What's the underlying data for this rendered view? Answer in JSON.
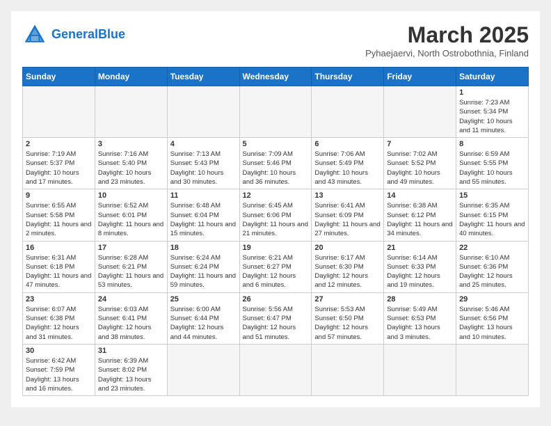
{
  "header": {
    "logo_general": "General",
    "logo_blue": "Blue",
    "title": "March 2025",
    "subtitle": "Pyhaejaervi, North Ostrobothnia, Finland"
  },
  "days_of_week": [
    "Sunday",
    "Monday",
    "Tuesday",
    "Wednesday",
    "Thursday",
    "Friday",
    "Saturday"
  ],
  "weeks": [
    [
      {
        "day": "",
        "info": ""
      },
      {
        "day": "",
        "info": ""
      },
      {
        "day": "",
        "info": ""
      },
      {
        "day": "",
        "info": ""
      },
      {
        "day": "",
        "info": ""
      },
      {
        "day": "",
        "info": ""
      },
      {
        "day": "1",
        "info": "Sunrise: 7:23 AM\nSunset: 5:34 PM\nDaylight: 10 hours and 11 minutes."
      }
    ],
    [
      {
        "day": "2",
        "info": "Sunrise: 7:19 AM\nSunset: 5:37 PM\nDaylight: 10 hours and 17 minutes."
      },
      {
        "day": "3",
        "info": "Sunrise: 7:16 AM\nSunset: 5:40 PM\nDaylight: 10 hours and 23 minutes."
      },
      {
        "day": "4",
        "info": "Sunrise: 7:13 AM\nSunset: 5:43 PM\nDaylight: 10 hours and 30 minutes."
      },
      {
        "day": "5",
        "info": "Sunrise: 7:09 AM\nSunset: 5:46 PM\nDaylight: 10 hours and 36 minutes."
      },
      {
        "day": "6",
        "info": "Sunrise: 7:06 AM\nSunset: 5:49 PM\nDaylight: 10 hours and 43 minutes."
      },
      {
        "day": "7",
        "info": "Sunrise: 7:02 AM\nSunset: 5:52 PM\nDaylight: 10 hours and 49 minutes."
      },
      {
        "day": "8",
        "info": "Sunrise: 6:59 AM\nSunset: 5:55 PM\nDaylight: 10 hours and 55 minutes."
      }
    ],
    [
      {
        "day": "9",
        "info": "Sunrise: 6:55 AM\nSunset: 5:58 PM\nDaylight: 11 hours and 2 minutes."
      },
      {
        "day": "10",
        "info": "Sunrise: 6:52 AM\nSunset: 6:01 PM\nDaylight: 11 hours and 8 minutes."
      },
      {
        "day": "11",
        "info": "Sunrise: 6:48 AM\nSunset: 6:04 PM\nDaylight: 11 hours and 15 minutes."
      },
      {
        "day": "12",
        "info": "Sunrise: 6:45 AM\nSunset: 6:06 PM\nDaylight: 11 hours and 21 minutes."
      },
      {
        "day": "13",
        "info": "Sunrise: 6:41 AM\nSunset: 6:09 PM\nDaylight: 11 hours and 27 minutes."
      },
      {
        "day": "14",
        "info": "Sunrise: 6:38 AM\nSunset: 6:12 PM\nDaylight: 11 hours and 34 minutes."
      },
      {
        "day": "15",
        "info": "Sunrise: 6:35 AM\nSunset: 6:15 PM\nDaylight: 11 hours and 40 minutes."
      }
    ],
    [
      {
        "day": "16",
        "info": "Sunrise: 6:31 AM\nSunset: 6:18 PM\nDaylight: 11 hours and 47 minutes."
      },
      {
        "day": "17",
        "info": "Sunrise: 6:28 AM\nSunset: 6:21 PM\nDaylight: 11 hours and 53 minutes."
      },
      {
        "day": "18",
        "info": "Sunrise: 6:24 AM\nSunset: 6:24 PM\nDaylight: 11 hours and 59 minutes."
      },
      {
        "day": "19",
        "info": "Sunrise: 6:21 AM\nSunset: 6:27 PM\nDaylight: 12 hours and 6 minutes."
      },
      {
        "day": "20",
        "info": "Sunrise: 6:17 AM\nSunset: 6:30 PM\nDaylight: 12 hours and 12 minutes."
      },
      {
        "day": "21",
        "info": "Sunrise: 6:14 AM\nSunset: 6:33 PM\nDaylight: 12 hours and 19 minutes."
      },
      {
        "day": "22",
        "info": "Sunrise: 6:10 AM\nSunset: 6:36 PM\nDaylight: 12 hours and 25 minutes."
      }
    ],
    [
      {
        "day": "23",
        "info": "Sunrise: 6:07 AM\nSunset: 6:38 PM\nDaylight: 12 hours and 31 minutes."
      },
      {
        "day": "24",
        "info": "Sunrise: 6:03 AM\nSunset: 6:41 PM\nDaylight: 12 hours and 38 minutes."
      },
      {
        "day": "25",
        "info": "Sunrise: 6:00 AM\nSunset: 6:44 PM\nDaylight: 12 hours and 44 minutes."
      },
      {
        "day": "26",
        "info": "Sunrise: 5:56 AM\nSunset: 6:47 PM\nDaylight: 12 hours and 51 minutes."
      },
      {
        "day": "27",
        "info": "Sunrise: 5:53 AM\nSunset: 6:50 PM\nDaylight: 12 hours and 57 minutes."
      },
      {
        "day": "28",
        "info": "Sunrise: 5:49 AM\nSunset: 6:53 PM\nDaylight: 13 hours and 3 minutes."
      },
      {
        "day": "29",
        "info": "Sunrise: 5:46 AM\nSunset: 6:56 PM\nDaylight: 13 hours and 10 minutes."
      }
    ],
    [
      {
        "day": "30",
        "info": "Sunrise: 6:42 AM\nSunset: 7:59 PM\nDaylight: 13 hours and 16 minutes."
      },
      {
        "day": "31",
        "info": "Sunrise: 6:39 AM\nSunset: 8:02 PM\nDaylight: 13 hours and 23 minutes."
      },
      {
        "day": "",
        "info": ""
      },
      {
        "day": "",
        "info": ""
      },
      {
        "day": "",
        "info": ""
      },
      {
        "day": "",
        "info": ""
      },
      {
        "day": "",
        "info": ""
      }
    ]
  ]
}
